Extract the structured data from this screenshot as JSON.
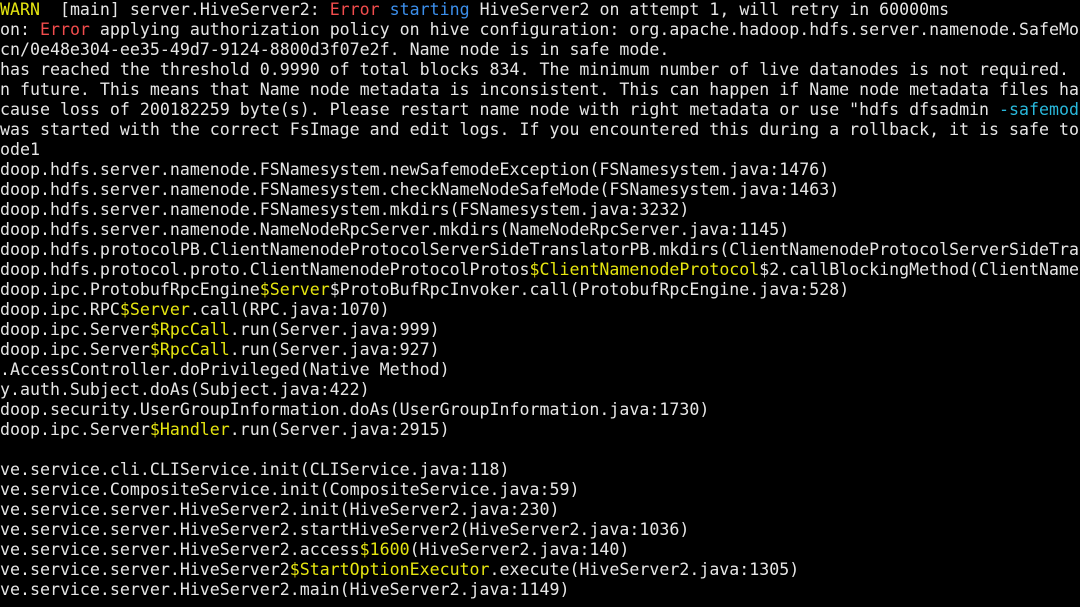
{
  "colors": {
    "background": "#000000",
    "default": "#e6e6e6",
    "yellow": "#e5e510",
    "blue": "#3b8eea",
    "red": "#f14c4c",
    "cyan": "#29b8db"
  },
  "lines": [
    [
      {
        "t": "WARN",
        "c": "yellow"
      },
      {
        "t": "  [main] server.HiveServer2: ",
        "c": "default"
      },
      {
        "t": "Error",
        "c": "red"
      },
      {
        "t": " ",
        "c": "default"
      },
      {
        "t": "starting",
        "c": "blue"
      },
      {
        "t": " HiveServer2 on attempt 1, will retry in 60000ms",
        "c": "default"
      }
    ],
    [
      {
        "t": "on: ",
        "c": "default"
      },
      {
        "t": "Error",
        "c": "red"
      },
      {
        "t": " applying authorization policy on hive configuration: org.apache.hadoop.hdfs.server.namenode.SafeMod",
        "c": "default"
      }
    ],
    [
      {
        "t": "cn/0e48e304-ee35-49d7-9124-8800d3f07e2f. Name node is in safe mode.",
        "c": "default"
      }
    ],
    [
      {
        "t": "has reached the threshold 0.9990 of total blocks 834. The minimum number of live datanodes is not required. I",
        "c": "default"
      }
    ],
    [
      {
        "t": "n future. This means that Name node metadata is inconsistent. This can happen if Name node metadata files hav",
        "c": "default"
      }
    ],
    [
      {
        "t": "cause loss of 200182259 byte(s). Please restart name node with right metadata or use \"hdfs dfsadmin ",
        "c": "default"
      },
      {
        "t": "-safemod",
        "c": "cyan"
      }
    ],
    [
      {
        "t": "was started with the correct FsImage and edit logs. If you encountered this during a rollback, it is safe to",
        "c": "default"
      }
    ],
    [
      {
        "t": "ode1",
        "c": "default"
      }
    ],
    [
      {
        "t": "doop.hdfs.server.namenode.FSNamesystem.newSafemodeException(FSNamesystem.java:1476)",
        "c": "default"
      }
    ],
    [
      {
        "t": "doop.hdfs.server.namenode.FSNamesystem.checkNameNodeSafeMode(FSNamesystem.java:1463)",
        "c": "default"
      }
    ],
    [
      {
        "t": "doop.hdfs.server.namenode.FSNamesystem.mkdirs(FSNamesystem.java:3232)",
        "c": "default"
      }
    ],
    [
      {
        "t": "doop.hdfs.server.namenode.NameNodeRpcServer.mkdirs(NameNodeRpcServer.java:1145)",
        "c": "default"
      }
    ],
    [
      {
        "t": "doop.hdfs.protocolPB.ClientNamenodeProtocolServerSideTranslatorPB.mkdirs(ClientNamenodeProtocolServerSideTran",
        "c": "default"
      }
    ],
    [
      {
        "t": "doop.hdfs.protocol.proto.ClientNamenodeProtocolProtos",
        "c": "default"
      },
      {
        "t": "$ClientNamenodeProtocol",
        "c": "yellow"
      },
      {
        "t": "$2.callBlockingMethod(ClientNamen",
        "c": "default"
      }
    ],
    [
      {
        "t": "doop.ipc.ProtobufRpcEngine",
        "c": "default"
      },
      {
        "t": "$Server",
        "c": "yellow"
      },
      {
        "t": "$ProtoBufRpcInvoker.call(ProtobufRpcEngine.java:528)",
        "c": "default"
      }
    ],
    [
      {
        "t": "doop.ipc.RPC",
        "c": "default"
      },
      {
        "t": "$Server",
        "c": "yellow"
      },
      {
        "t": ".call(RPC.java:1070)",
        "c": "default"
      }
    ],
    [
      {
        "t": "doop.ipc.Server",
        "c": "default"
      },
      {
        "t": "$RpcCall",
        "c": "yellow"
      },
      {
        "t": ".run(Server.java:999)",
        "c": "default"
      }
    ],
    [
      {
        "t": "doop.ipc.Server",
        "c": "default"
      },
      {
        "t": "$RpcCall",
        "c": "yellow"
      },
      {
        "t": ".run(Server.java:927)",
        "c": "default"
      }
    ],
    [
      {
        "t": ".AccessController.doPrivileged(Native Method)",
        "c": "default"
      }
    ],
    [
      {
        "t": "y.auth.Subject.doAs(Subject.java:422)",
        "c": "default"
      }
    ],
    [
      {
        "t": "doop.security.UserGroupInformation.doAs(UserGroupInformation.java:1730)",
        "c": "default"
      }
    ],
    [
      {
        "t": "doop.ipc.Server",
        "c": "default"
      },
      {
        "t": "$Handler",
        "c": "yellow"
      },
      {
        "t": ".run(Server.java:2915)",
        "c": "default"
      }
    ],
    [],
    [
      {
        "t": "ve.service.cli.CLIService.init(CLIService.java:118)",
        "c": "default"
      }
    ],
    [
      {
        "t": "ve.service.CompositeService.init(CompositeService.java:59)",
        "c": "default"
      }
    ],
    [
      {
        "t": "ve.service.server.HiveServer2.init(HiveServer2.java:230)",
        "c": "default"
      }
    ],
    [
      {
        "t": "ve.service.server.HiveServer2.startHiveServer2(HiveServer2.java:1036)",
        "c": "default"
      }
    ],
    [
      {
        "t": "ve.service.server.HiveServer2.access",
        "c": "default"
      },
      {
        "t": "$1600",
        "c": "yellow"
      },
      {
        "t": "(HiveServer2.java:140)",
        "c": "default"
      }
    ],
    [
      {
        "t": "ve.service.server.HiveServer2",
        "c": "default"
      },
      {
        "t": "$StartOptionExecutor",
        "c": "yellow"
      },
      {
        "t": ".execute(HiveServer2.java:1305)",
        "c": "default"
      }
    ],
    [
      {
        "t": "ve.service.server.HiveServer2.main(HiveServer2.java:1149)",
        "c": "default"
      }
    ]
  ]
}
